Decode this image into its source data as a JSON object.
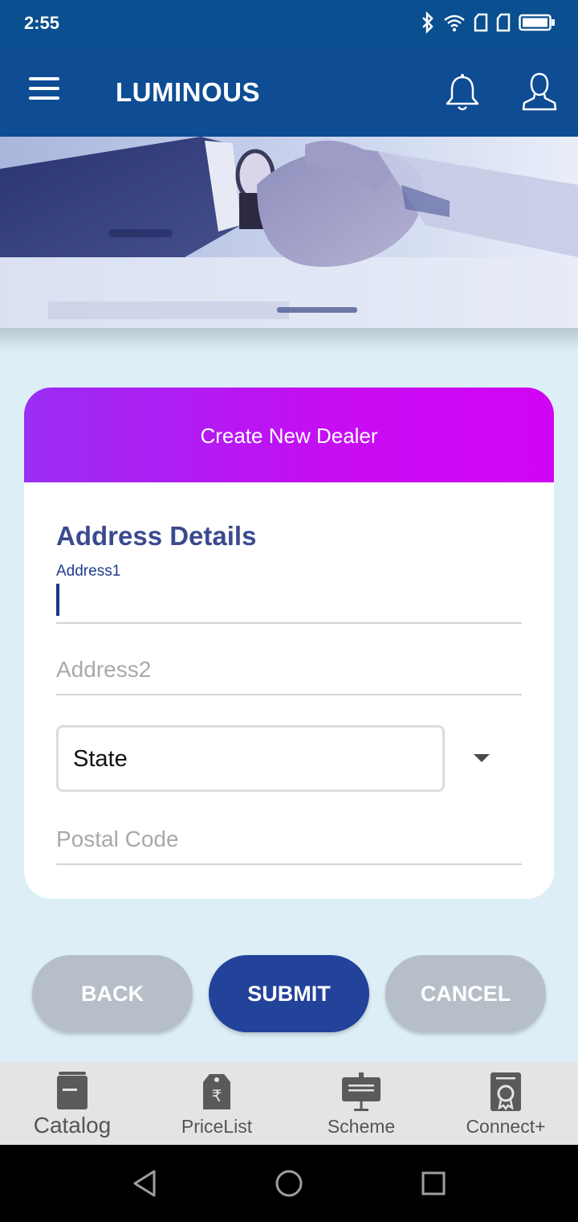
{
  "status_bar": {
    "time": "2:55",
    "icons": [
      "bluetooth-icon",
      "wifi-icon",
      "sim1-icon",
      "sim2-icon",
      "battery-icon"
    ]
  },
  "app_bar": {
    "title": "LUMINOUS",
    "icons": [
      "menu-icon",
      "bell-icon",
      "profile-icon"
    ]
  },
  "form": {
    "header": "Create New Dealer",
    "section_title": "Address Details",
    "address1": {
      "label": "Address1",
      "value": ""
    },
    "address2": {
      "placeholder": "Address2",
      "value": ""
    },
    "state": {
      "selected": "State"
    },
    "postal_code": {
      "placeholder": "Postal Code",
      "value": ""
    }
  },
  "actions": {
    "back": "BACK",
    "submit": "SUBMIT",
    "cancel": "CANCEL"
  },
  "bottom_nav": [
    {
      "label": "Catalog",
      "icon": "catalog-icon"
    },
    {
      "label": "PriceList",
      "icon": "pricelist-icon"
    },
    {
      "label": "Scheme",
      "icon": "scheme-icon"
    },
    {
      "label": "Connect+",
      "icon": "connect-icon"
    }
  ],
  "colors": {
    "app_bar": "#0e4c94",
    "header_gradient_start": "#9a2ef3",
    "header_gradient_end": "#d104f4",
    "primary_button": "#23429a",
    "secondary_button": "#b6bfc8",
    "section_title": "#3b4a8f"
  }
}
